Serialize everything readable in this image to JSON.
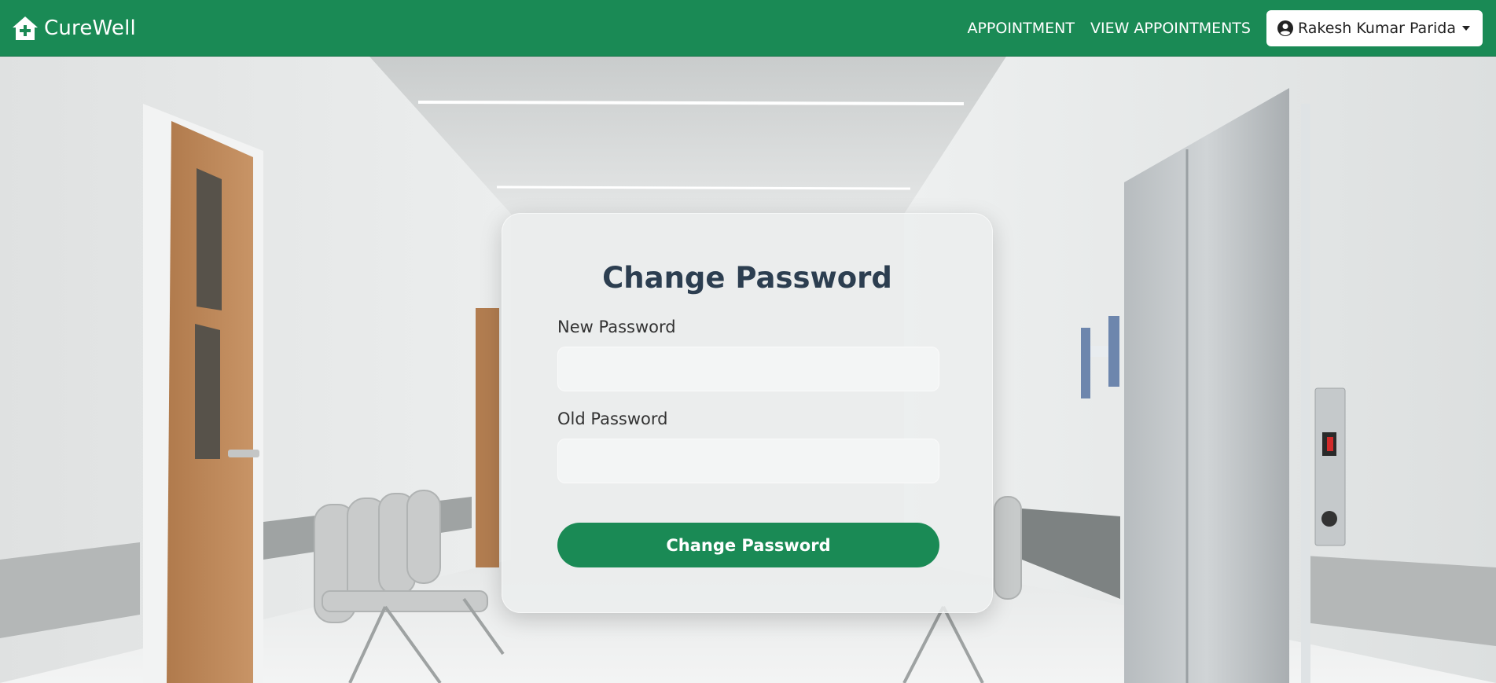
{
  "navbar": {
    "brand_name": "CureWell",
    "brand_icon": "house-plus-icon",
    "links": [
      "APPOINTMENT",
      "VIEW APPOINTMENTS"
    ],
    "user_name": "Rakesh Kumar Parida",
    "user_icon": "user-circle-icon",
    "color": "#1a8a55"
  },
  "form": {
    "title": "Change Password",
    "new_password_label": "New Password",
    "new_password_value": "",
    "old_password_label": "Old Password",
    "old_password_value": "",
    "submit_label": "Change Password",
    "accent_color": "#1a8a55",
    "title_color": "#2c3e50"
  }
}
